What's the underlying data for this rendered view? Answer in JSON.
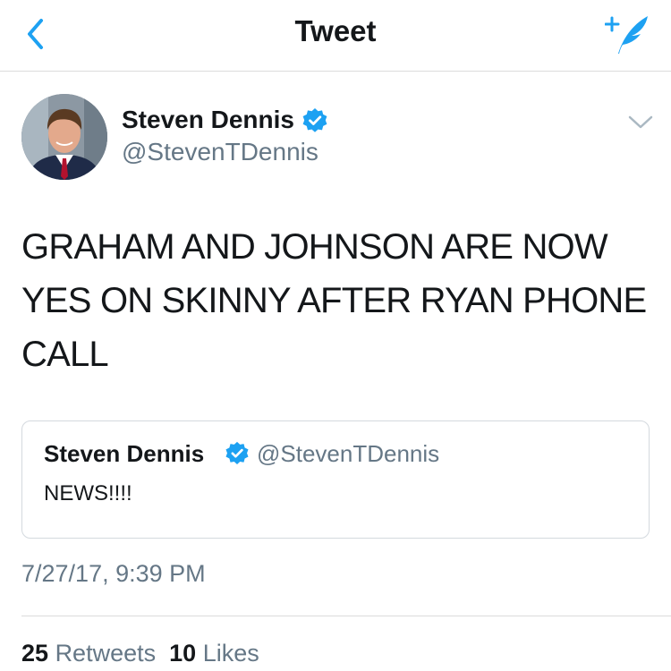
{
  "nav": {
    "title": "Tweet"
  },
  "icons": {
    "back": "chevron-left-icon",
    "compose": "compose-tweet-icon",
    "verified": "verified-badge-icon",
    "menu": "chevron-down-icon"
  },
  "colors": {
    "accent": "#1da1f2",
    "text": "#14171a",
    "secondary": "#657786",
    "border": "#dcdcdc"
  },
  "tweet": {
    "author": {
      "name": "Steven Dennis",
      "handle": "@StevenTDennis",
      "verified": true
    },
    "text_lines": [
      "GRAHAM AND JOHNSON ARE NOW",
      "YES ON SKINNY AFTER RYAN PHONE",
      "CALL"
    ],
    "quoted": {
      "name": "Steven Dennis",
      "handle": "@StevenTDennis",
      "verified": true,
      "text": "NEWS!!!!"
    },
    "timestamp": "7/27/17, 9:39 PM",
    "stats": {
      "retweets_count": "25",
      "retweets_label": "Retweets",
      "likes_count": "10",
      "likes_label": "Likes"
    }
  }
}
